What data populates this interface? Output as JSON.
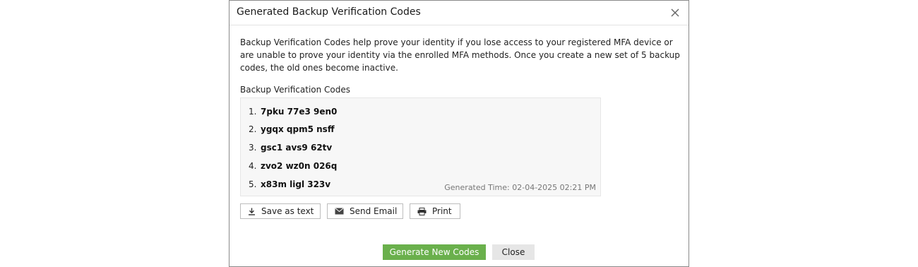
{
  "dialog": {
    "title": "Generated Backup Verification Codes",
    "close_icon": "close-icon",
    "description": "Backup Verification Codes help prove your identity if you lose access to your registered MFA device or are unable to prove your identity via the enrolled MFA methods. Once you create a new set of 5 backup codes, the old ones become inactive.",
    "codes_label": "Backup Verification Codes",
    "codes": [
      {
        "num": "1.",
        "value": "7pku 77e3 9en0"
      },
      {
        "num": "2.",
        "value": "ygqx qpm5 nsff"
      },
      {
        "num": "3.",
        "value": "gsc1 avs9 62tv"
      },
      {
        "num": "4.",
        "value": "zvo2 wz0n 026q"
      },
      {
        "num": "5.",
        "value": "x83m ligl 323v"
      }
    ],
    "generated_time": "Generated Time: 02-04-2025 02:21 PM"
  },
  "actions": {
    "save_label": "Save as text",
    "save_icon": "download-icon",
    "email_label": "Send Email",
    "email_icon": "envelope-icon",
    "print_label": "Print",
    "print_icon": "printer-icon"
  },
  "footer": {
    "generate_label": "Generate New Codes",
    "close_label": "Close"
  },
  "colors": {
    "primary_button": "#6ab04c",
    "secondary_button": "#e6e6e6",
    "codes_background": "#f7f7f7"
  }
}
